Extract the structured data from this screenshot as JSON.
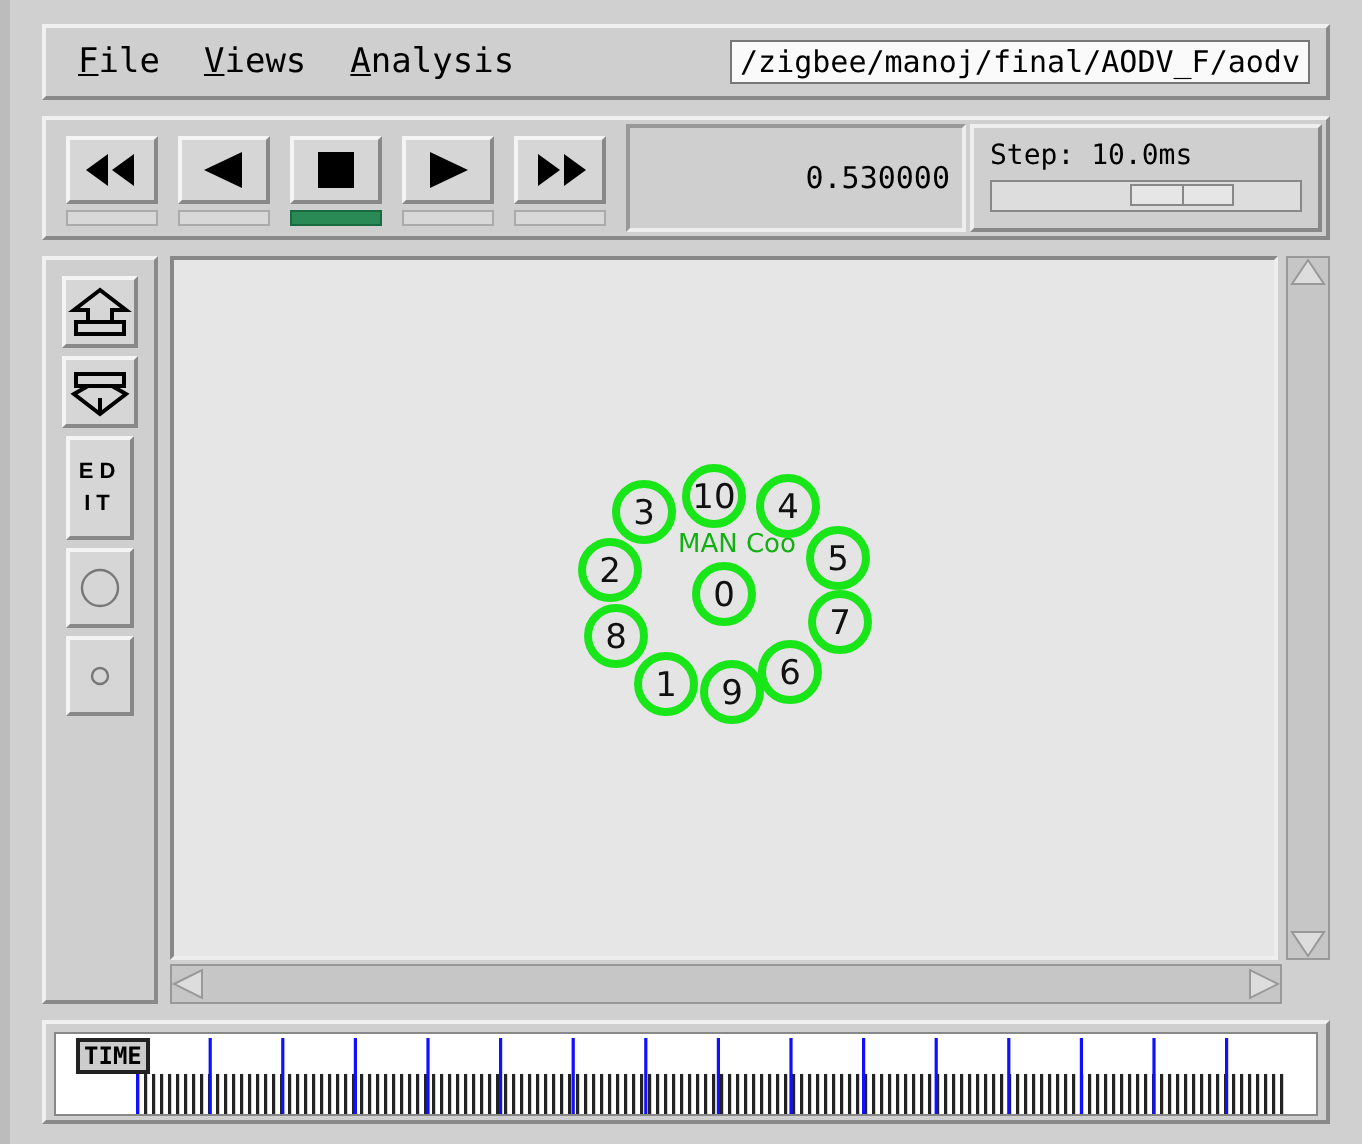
{
  "menu": [
    {
      "label": "File"
    },
    {
      "label": "Views"
    },
    {
      "label": "Analysis"
    }
  ],
  "file_path": "/zigbee/manoj/final/AODV_F/aodv",
  "playback": [
    {
      "kind": "rewind",
      "selected": false
    },
    {
      "kind": "back",
      "selected": false
    },
    {
      "kind": "stop",
      "selected": true
    },
    {
      "kind": "play",
      "selected": false
    },
    {
      "kind": "forward",
      "selected": false
    }
  ],
  "time": "0.530000",
  "step": {
    "label": "Step: 10.0ms",
    "level": 0.62
  },
  "tools": [
    {
      "kind": "zoom-in"
    },
    {
      "kind": "zoom-out"
    },
    {
      "kind": "edit",
      "label": "ED IT"
    },
    {
      "kind": "big-circle"
    },
    {
      "kind": "small-circle"
    }
  ],
  "canvas": {
    "caption": "MAN Coo",
    "nodes": [
      {
        "label": "10"
      },
      {
        "label": "3"
      },
      {
        "label": "4"
      },
      {
        "label": "5"
      },
      {
        "label": "2"
      },
      {
        "label": "0"
      },
      {
        "label": "7"
      },
      {
        "label": "8"
      },
      {
        "label": "6"
      },
      {
        "label": "1"
      },
      {
        "label": "9"
      }
    ]
  },
  "timeline": {
    "label": "TIME"
  }
}
